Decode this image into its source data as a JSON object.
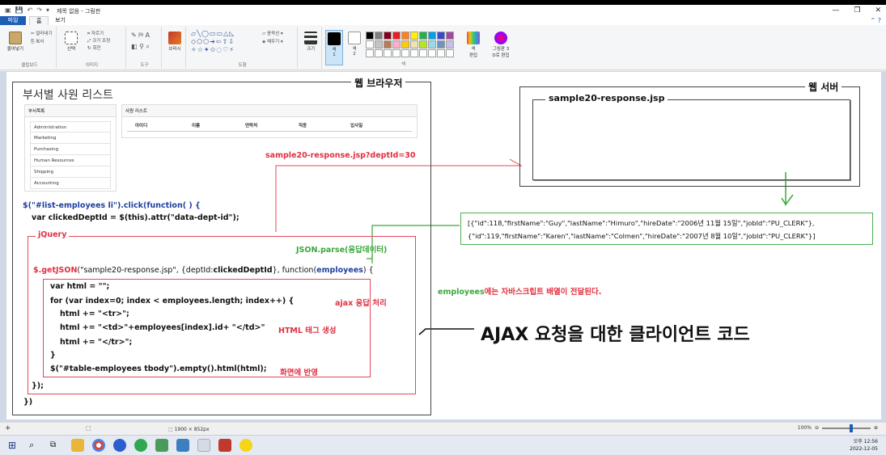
{
  "window": {
    "title": "제목 없음 - 그림판",
    "minimize": "—",
    "restore": "❐",
    "close": "✕"
  },
  "quick_access": [
    "▣",
    "💾",
    "↶",
    "↷",
    "▾"
  ],
  "tabs": {
    "file": "파일",
    "home": "홈",
    "view": "보기"
  },
  "ribbon": {
    "clipboard": {
      "paste": "붙여넣기",
      "cut": "잘라내기",
      "copy": "복사",
      "label": "클립보드"
    },
    "image": {
      "select": "선택",
      "crop": "자르기",
      "resize": "크기 조정",
      "rotate": "회전",
      "label": "이미지"
    },
    "tools": {
      "label": "도구"
    },
    "brushes": {
      "label": "브러시"
    },
    "shapes": {
      "outline": "윤곽선",
      "fill": "채우기",
      "label": "도형"
    },
    "size": {
      "label": "크기"
    },
    "color1": {
      "label": "색\n1"
    },
    "color2": {
      "label": "색\n2"
    },
    "colors": {
      "label": "색"
    },
    "edit_colors": {
      "label": "색\n편집"
    },
    "paint3d": {
      "label": "그림판 3\nD로 편집"
    },
    "colors_list": [
      "#000000",
      "#7f7f7f",
      "#880015",
      "#ed1c24",
      "#ff7f27",
      "#fff200",
      "#22b14c",
      "#00a2e8",
      "#3f48cc",
      "#a349a4",
      "#ffffff",
      "#c3c3c3",
      "#b97a57",
      "#ffaec9",
      "#ffc90e",
      "#efe4b0",
      "#b5e61d",
      "#99d9ea",
      "#7092be",
      "#c8bfe7"
    ]
  },
  "status": {
    "size": "1900 × 852px",
    "zoom": "100%"
  },
  "clock": {
    "time": "오후 12:56",
    "date": "2022-12-05"
  },
  "diagram": {
    "browser_label": "웹 브라우저",
    "server_label": "웹 서버",
    "page_title": "부서별 사원 리스트",
    "dept_panel_title": "부서목록",
    "departments": [
      "Administration",
      "Marketing",
      "Purchasing",
      "Human Resources",
      "Shipping",
      "Accounting"
    ],
    "emp_panel_title": "사원 리스트",
    "emp_columns": [
      "아이디",
      "이름",
      "연락처",
      "직종",
      "입사일"
    ],
    "request_url": "sample20-response.jsp?deptId=30",
    "server_file": "sample20-response.jsp",
    "json_line1": "[{\"id\":118,\"firstName\":\"Guy\",\"lastName\":\"Himuro\",\"hireDate\":\"2006년 11월 15일\",\"jobId\":\"PU_CLERK\"},",
    "json_line2": "{\"id\":119,\"firstName\":\"Karen\",\"lastName\":\"Colmen\",\"hireDate\":\"2007년 8월 10일\",\"jobId\":\"PU_CLERK\"}]",
    "code_click": "$(\"#list-employees li\").click(function( ) {",
    "code_var": "var clickedDeptId = $(this).attr(\"data-dept-id\");",
    "jquery_label": "jQuery",
    "json_parse_label": "JSON.parse(응답데이터)",
    "code_getjson_a": "$.getJSON",
    "code_getjson_b": "(\"sample20-response.jsp\", {deptId:",
    "code_getjson_c": "clickedDeptId",
    "code_getjson_d": "}, function(",
    "code_getjson_e": "employees",
    "code_getjson_f": ") {",
    "code_html": "var html = \"\";",
    "code_for": "for (var index=0; index < employees.length; index++) {",
    "code_tr": "html += \"<tr>\";",
    "code_td": "html += \"<td>\"+employees[index].id+ \"</td>\"",
    "code_etr": "html += \"</tr>\";",
    "code_close1": "}",
    "code_table": "$(\"#table-employees tbody\").empty().html(html);",
    "code_close2": "});",
    "code_close3": "})",
    "ajax_label": "ajax 응답 처리",
    "html_tag_label": "HTML 태그 생성",
    "render_label": "화면에 반영",
    "employees_note_a": "employees",
    "employees_note_b": "에는 자바스크립트 배열이 전달된다.",
    "big_caption": "AJAX 요청을 대한 클라이언트 코드"
  }
}
